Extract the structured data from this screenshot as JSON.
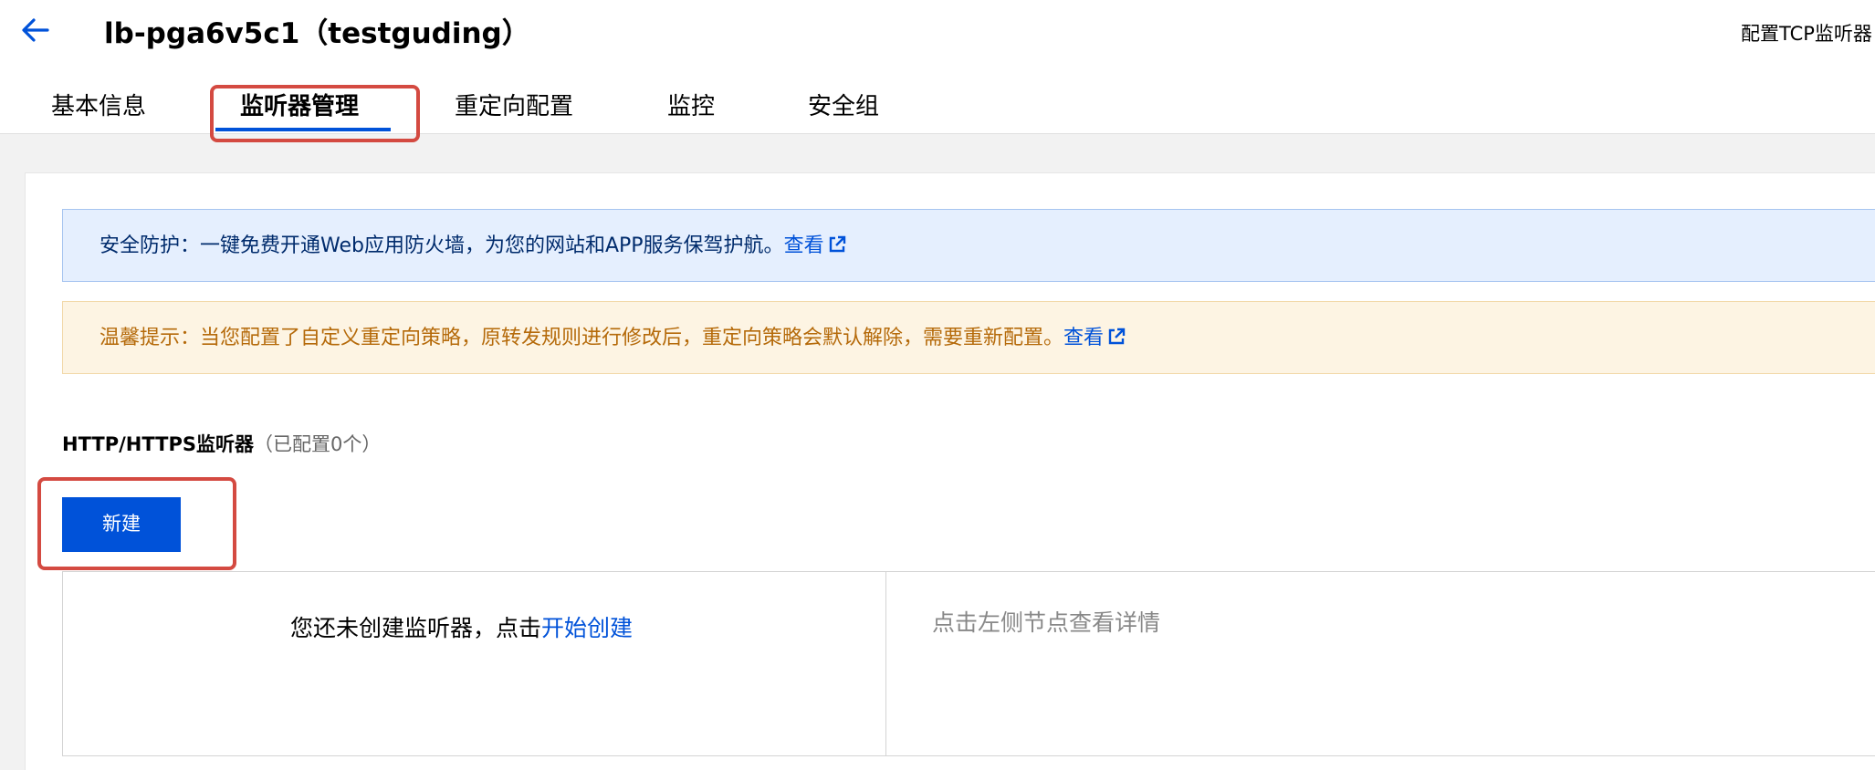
{
  "header": {
    "title": "lb-pga6v5c1（testguding）",
    "right_link": "配置TCP监听器"
  },
  "tabs": [
    {
      "label": "基本信息",
      "active": false
    },
    {
      "label": "监听器管理",
      "active": true
    },
    {
      "label": "重定向配置",
      "active": false
    },
    {
      "label": "监控",
      "active": false
    },
    {
      "label": "安全组",
      "active": false
    }
  ],
  "notices": {
    "info": {
      "text": "安全防护：一键免费开通Web应用防火墙，为您的网站和APP服务保驾护航。",
      "link": "查看"
    },
    "warning": {
      "text": "温馨提示：当您配置了自定义重定向策略，原转发规则进行修改后，重定向策略会默认解除，需要重新配置。",
      "link": "查看"
    }
  },
  "listeners": {
    "title": "HTTP/HTTPS监听器",
    "count": "（已配置0个）",
    "new_button": "新建",
    "empty_text": "您还未创建监听器，点击",
    "empty_link": "开始创建",
    "detail_hint": "点击左侧节点查看详情"
  },
  "colors": {
    "accent": "#0052d9",
    "annotation": "#d44a41",
    "info_bg": "#e5effe",
    "warn_bg": "#fdf4e3",
    "warn_text": "#b56a0a"
  },
  "icons": {
    "back": "arrow-left-icon",
    "external": "external-link-icon"
  }
}
